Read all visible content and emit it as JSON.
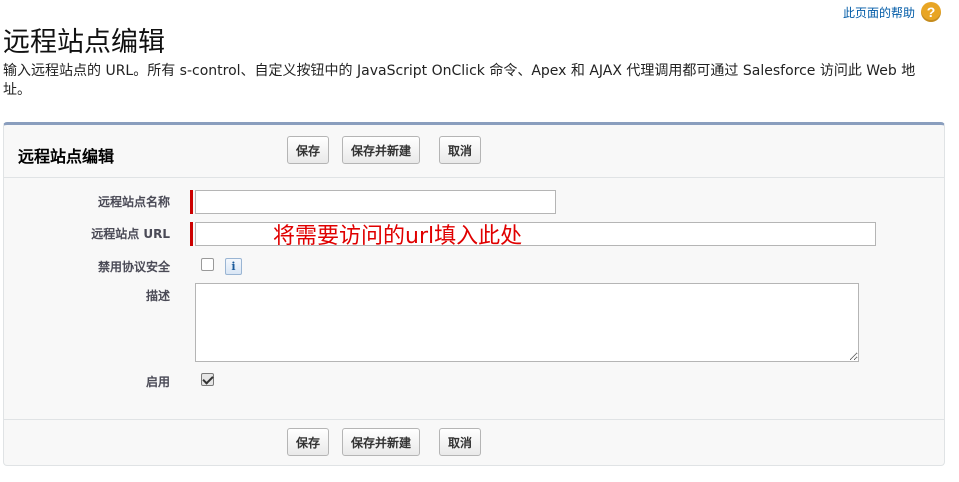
{
  "page": {
    "title": "远程站点编辑",
    "help_link": "此页面的帮助",
    "help_icon": "question-mark-icon",
    "intro": "输入远程站点的 URL。所有 s-control、自定义按钮中的 JavaScript OnClick 命令、Apex 和 AJAX 代理调用都可通过 Salesforce 访问此 Web 地址。"
  },
  "panel": {
    "title": "远程站点编辑",
    "buttons": {
      "save": "保存",
      "save_new": "保存并新建",
      "cancel": "取消"
    }
  },
  "form": {
    "site_name_label": "远程站点名称",
    "site_name_value": "",
    "site_url_label": "远程站点 URL",
    "site_url_value": "",
    "disable_protocol_label": "禁用协议安全",
    "disable_protocol_checked": false,
    "info_icon": "i",
    "description_label": "描述",
    "description_value": "",
    "active_label": "启用",
    "active_checked": true
  },
  "annotation": "将需要访问的url填入此处",
  "colors": {
    "required": "#cc0000",
    "annotation": "#e00000",
    "panel_border": "#8a9ebe",
    "link": "#015ba7"
  }
}
